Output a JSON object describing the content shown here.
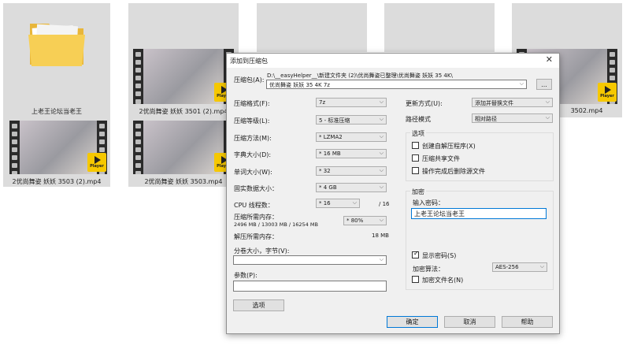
{
  "explorer": {
    "folder_label": "上老王论坛当老王",
    "files": [
      {
        "name": "2优尚舞姿 妖妖 3501 (2).mp4"
      },
      {
        "name": "2优尚舞姿 妖妖 3503 (2).mp4"
      },
      {
        "name": "2优尚舞姿 妖妖 3503.mp4"
      },
      {
        "name": "3502.mp4"
      }
    ],
    "badge_text": "Player"
  },
  "dialog": {
    "title": "添加到压缩包",
    "close_glyph": "✕",
    "archive_label": "压缩包(A):",
    "archive_path": "D:\\__easyHelper__\\新建文件夹 (2)\\优尚舞姿已整理\\优尚舞姿 妖妖 35 4K\\",
    "archive_name": "优尚舞姿 妖妖 35 4K 7z",
    "browse_label": "...",
    "left": {
      "format_label": "压缩格式(F):",
      "format_value": "7z",
      "level_label": "压缩等级(L):",
      "level_value": "5 - 标准压缩",
      "method_label": "压缩方法(M):",
      "method_value": "* LZMA2",
      "dict_label": "字典大小(D):",
      "dict_value": "* 16 MB",
      "word_label": "单词大小(W):",
      "word_value": "* 32",
      "solid_label": "固实数据大小：",
      "solid_value": "* 4 GB",
      "threads_label": "CPU 线程数：",
      "threads_value": "* 16",
      "threads_max": "/ 16",
      "mem_comp_label": "压缩所需内存：",
      "mem_comp_value": "2496 MB / 13003 MB / 16254 MB",
      "mem_pct": "* 80%",
      "mem_decomp_label": "解压所需内存：",
      "mem_decomp_value": "18 MB",
      "split_label": "分卷大小，字节(V):",
      "split_value": "",
      "params_label": "参数(P):",
      "params_value": "",
      "options_button": "选项"
    },
    "right": {
      "update_label": "更新方式(U):",
      "update_value": "添加并替换文件",
      "path_label": "路径模式",
      "path_value": "相对路径",
      "options_group": "选项",
      "opt_sfx": "创建自解压程序(X)",
      "opt_shared": "压缩共享文件",
      "opt_delete": "操作完成后删除源文件",
      "encrypt_group": "加密",
      "password_label": "输入密码：",
      "password_value": "上老王论坛当老王",
      "show_password": "显示密码(S)",
      "enc_method_label": "加密算法：",
      "enc_method_value": "AES-256",
      "enc_names": "加密文件名(N)"
    },
    "buttons": {
      "ok": "确定",
      "cancel": "取消",
      "help": "帮助"
    }
  }
}
